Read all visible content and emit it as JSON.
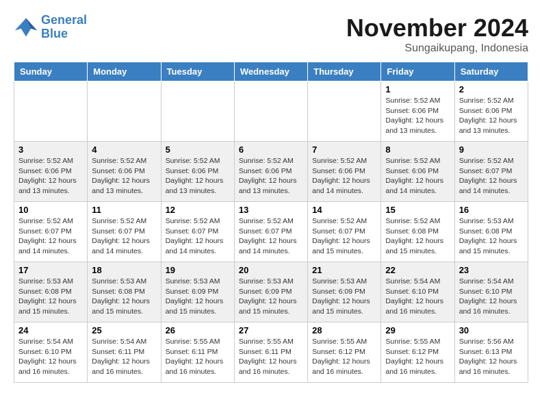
{
  "logo": {
    "text_general": "General",
    "text_blue": "Blue"
  },
  "header": {
    "month_title": "November 2024",
    "location": "Sungaikupang, Indonesia"
  },
  "days_of_week": [
    "Sunday",
    "Monday",
    "Tuesday",
    "Wednesday",
    "Thursday",
    "Friday",
    "Saturday"
  ],
  "weeks": [
    {
      "alt": false,
      "cells": [
        {
          "day": "",
          "info": ""
        },
        {
          "day": "",
          "info": ""
        },
        {
          "day": "",
          "info": ""
        },
        {
          "day": "",
          "info": ""
        },
        {
          "day": "",
          "info": ""
        },
        {
          "day": "1",
          "info": "Sunrise: 5:52 AM\nSunset: 6:06 PM\nDaylight: 12 hours\nand 13 minutes."
        },
        {
          "day": "2",
          "info": "Sunrise: 5:52 AM\nSunset: 6:06 PM\nDaylight: 12 hours\nand 13 minutes."
        }
      ]
    },
    {
      "alt": true,
      "cells": [
        {
          "day": "3",
          "info": "Sunrise: 5:52 AM\nSunset: 6:06 PM\nDaylight: 12 hours\nand 13 minutes."
        },
        {
          "day": "4",
          "info": "Sunrise: 5:52 AM\nSunset: 6:06 PM\nDaylight: 12 hours\nand 13 minutes."
        },
        {
          "day": "5",
          "info": "Sunrise: 5:52 AM\nSunset: 6:06 PM\nDaylight: 12 hours\nand 13 minutes."
        },
        {
          "day": "6",
          "info": "Sunrise: 5:52 AM\nSunset: 6:06 PM\nDaylight: 12 hours\nand 13 minutes."
        },
        {
          "day": "7",
          "info": "Sunrise: 5:52 AM\nSunset: 6:06 PM\nDaylight: 12 hours\nand 14 minutes."
        },
        {
          "day": "8",
          "info": "Sunrise: 5:52 AM\nSunset: 6:06 PM\nDaylight: 12 hours\nand 14 minutes."
        },
        {
          "day": "9",
          "info": "Sunrise: 5:52 AM\nSunset: 6:07 PM\nDaylight: 12 hours\nand 14 minutes."
        }
      ]
    },
    {
      "alt": false,
      "cells": [
        {
          "day": "10",
          "info": "Sunrise: 5:52 AM\nSunset: 6:07 PM\nDaylight: 12 hours\nand 14 minutes."
        },
        {
          "day": "11",
          "info": "Sunrise: 5:52 AM\nSunset: 6:07 PM\nDaylight: 12 hours\nand 14 minutes."
        },
        {
          "day": "12",
          "info": "Sunrise: 5:52 AM\nSunset: 6:07 PM\nDaylight: 12 hours\nand 14 minutes."
        },
        {
          "day": "13",
          "info": "Sunrise: 5:52 AM\nSunset: 6:07 PM\nDaylight: 12 hours\nand 14 minutes."
        },
        {
          "day": "14",
          "info": "Sunrise: 5:52 AM\nSunset: 6:07 PM\nDaylight: 12 hours\nand 15 minutes."
        },
        {
          "day": "15",
          "info": "Sunrise: 5:52 AM\nSunset: 6:08 PM\nDaylight: 12 hours\nand 15 minutes."
        },
        {
          "day": "16",
          "info": "Sunrise: 5:53 AM\nSunset: 6:08 PM\nDaylight: 12 hours\nand 15 minutes."
        }
      ]
    },
    {
      "alt": true,
      "cells": [
        {
          "day": "17",
          "info": "Sunrise: 5:53 AM\nSunset: 6:08 PM\nDaylight: 12 hours\nand 15 minutes."
        },
        {
          "day": "18",
          "info": "Sunrise: 5:53 AM\nSunset: 6:08 PM\nDaylight: 12 hours\nand 15 minutes."
        },
        {
          "day": "19",
          "info": "Sunrise: 5:53 AM\nSunset: 6:09 PM\nDaylight: 12 hours\nand 15 minutes."
        },
        {
          "day": "20",
          "info": "Sunrise: 5:53 AM\nSunset: 6:09 PM\nDaylight: 12 hours\nand 15 minutes."
        },
        {
          "day": "21",
          "info": "Sunrise: 5:53 AM\nSunset: 6:09 PM\nDaylight: 12 hours\nand 15 minutes."
        },
        {
          "day": "22",
          "info": "Sunrise: 5:54 AM\nSunset: 6:10 PM\nDaylight: 12 hours\nand 16 minutes."
        },
        {
          "day": "23",
          "info": "Sunrise: 5:54 AM\nSunset: 6:10 PM\nDaylight: 12 hours\nand 16 minutes."
        }
      ]
    },
    {
      "alt": false,
      "cells": [
        {
          "day": "24",
          "info": "Sunrise: 5:54 AM\nSunset: 6:10 PM\nDaylight: 12 hours\nand 16 minutes."
        },
        {
          "day": "25",
          "info": "Sunrise: 5:54 AM\nSunset: 6:11 PM\nDaylight: 12 hours\nand 16 minutes."
        },
        {
          "day": "26",
          "info": "Sunrise: 5:55 AM\nSunset: 6:11 PM\nDaylight: 12 hours\nand 16 minutes."
        },
        {
          "day": "27",
          "info": "Sunrise: 5:55 AM\nSunset: 6:11 PM\nDaylight: 12 hours\nand 16 minutes."
        },
        {
          "day": "28",
          "info": "Sunrise: 5:55 AM\nSunset: 6:12 PM\nDaylight: 12 hours\nand 16 minutes."
        },
        {
          "day": "29",
          "info": "Sunrise: 5:55 AM\nSunset: 6:12 PM\nDaylight: 12 hours\nand 16 minutes."
        },
        {
          "day": "30",
          "info": "Sunrise: 5:56 AM\nSunset: 6:13 PM\nDaylight: 12 hours\nand 16 minutes."
        }
      ]
    }
  ]
}
